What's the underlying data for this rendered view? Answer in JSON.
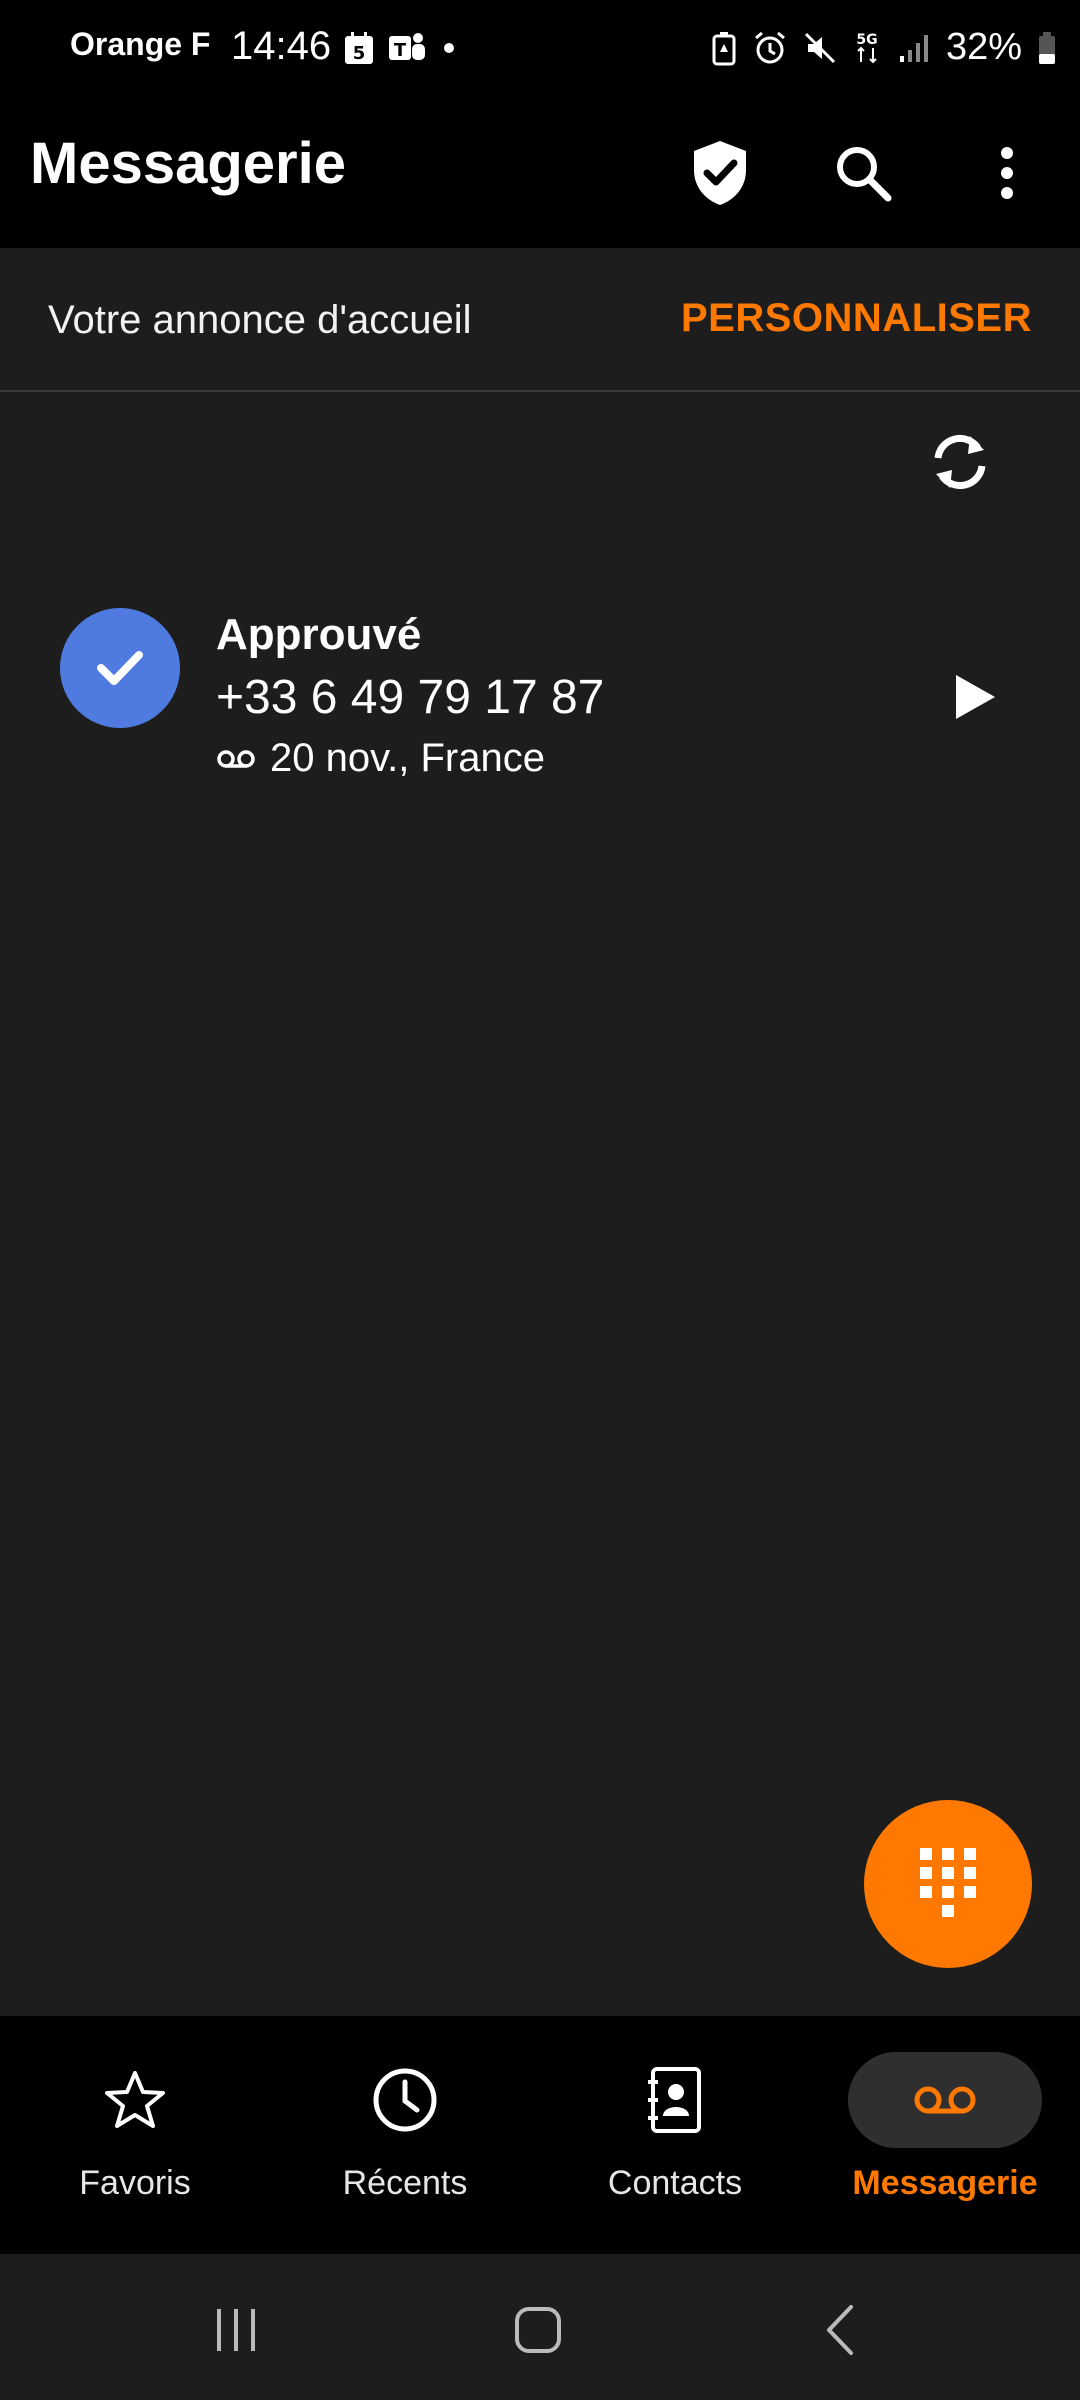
{
  "status_bar": {
    "carrier": "Orange F",
    "time": "14:46",
    "calendar_day": "5",
    "battery": "32%",
    "network": "5G"
  },
  "app_bar": {
    "title": "Messagerie",
    "icons": [
      "shield-check-icon",
      "search-icon",
      "more-vert-icon"
    ]
  },
  "greeting": {
    "text": "Votre annonce d'accueil",
    "action": "PERSONNALISER"
  },
  "messages": [
    {
      "status": "Approuvé",
      "number": "+33 6 49 79 17 87",
      "meta": "20 nov., France"
    }
  ],
  "bottom_nav": {
    "items": [
      {
        "label": "Favoris",
        "icon": "star-icon"
      },
      {
        "label": "Récents",
        "icon": "clock-icon"
      },
      {
        "label": "Contacts",
        "icon": "contacts-icon"
      },
      {
        "label": "Messagerie",
        "icon": "voicemail-icon"
      }
    ],
    "active": "Messagerie"
  },
  "colors": {
    "accent": "#ff7900",
    "avatar": "#4f7be0",
    "background": "#1d1d1d",
    "bar": "#000000"
  }
}
